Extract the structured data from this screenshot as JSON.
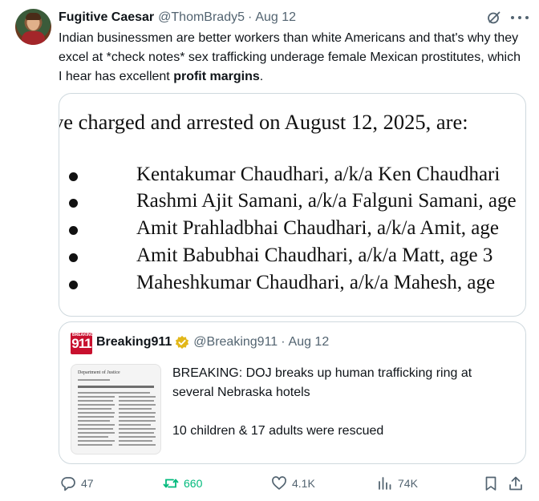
{
  "tweet": {
    "display_name": "Fugitive Caesar",
    "handle": "@ThomBrady5",
    "separator": "·",
    "date": "Aug 12",
    "text_before": "Indian businessmen are better workers than white Americans and that's why they excel at *check notes* sex trafficking underage female Mexican prostitutes, which I hear has excellent ",
    "text_bold": "profit margins",
    "text_after": "."
  },
  "document_image": {
    "heading": "ve charged and arrested on August 12, 2025, are:",
    "names": [
      "Kentakumar Chaudhari, a/k/a Ken Chaudhari",
      "Rashmi Ajit Samani, a/k/a Falguni Samani, age",
      "Amit Prahladbhai Chaudhari, a/k/a Amit, age",
      "Amit Babubhai Chaudhari, a/k/a Matt, age 3",
      "Maheshkumar Chaudhari, a/k/a Mahesh, age"
    ]
  },
  "quote": {
    "logo_text": "911",
    "logo_small": "BREAKING",
    "display_name": "Breaking911",
    "handle": "@Breaking911",
    "separator": "·",
    "date": "Aug 12",
    "line1": "BREAKING: DOJ breaks up human trafficking ring at several Nebraska hotels",
    "line2": "10 children & 17 adults were rescued",
    "thumb_title": "Department of Justice"
  },
  "actions": {
    "replies": "47",
    "reposts": "660",
    "likes": "4.1K",
    "views": "74K"
  },
  "icons": {
    "reply": "reply-icon",
    "repost": "repost-icon",
    "like": "heart-icon",
    "views": "views-icon",
    "bookmark": "bookmark-icon",
    "share": "share-icon",
    "grok": "grok-icon",
    "more": "more-icon",
    "verified": "verified-badge-icon"
  },
  "colors": {
    "repost_active": "#00ba7c",
    "secondary_text": "#536471",
    "verified_gold": "#e2b719",
    "logo_red": "#c8102e"
  }
}
